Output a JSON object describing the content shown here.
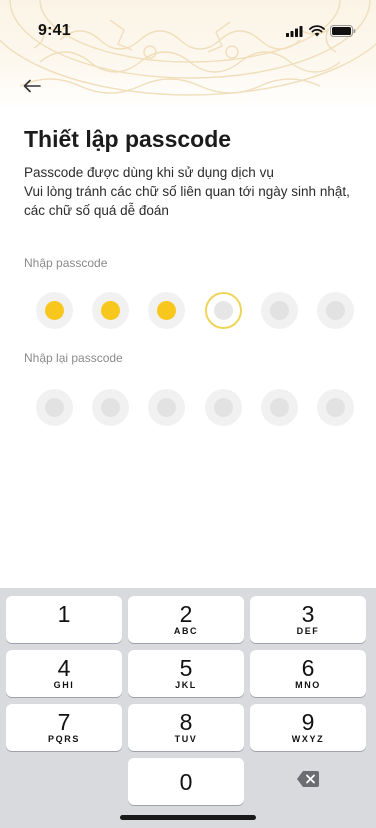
{
  "status_bar": {
    "time": "9:41"
  },
  "header": {
    "back_icon": "arrow-left-icon",
    "title": "Thiết lập passcode"
  },
  "description": {
    "line1": "Passcode được dùng khi sử dụng dịch vụ",
    "line2": "Vui lòng tránh các chữ số liên quan tới ngày sinh nhật, các chữ số quá dễ đoán"
  },
  "passcode": {
    "label": "Nhập passcode",
    "length": 6,
    "filled_count": 3
  },
  "confirm_passcode": {
    "label": "Nhập lại passcode",
    "length": 6,
    "filled_count": 0
  },
  "keypad": {
    "keys": [
      {
        "digit": "1",
        "letters": ""
      },
      {
        "digit": "2",
        "letters": "ABC"
      },
      {
        "digit": "3",
        "letters": "DEF"
      },
      {
        "digit": "4",
        "letters": "GHI"
      },
      {
        "digit": "5",
        "letters": "JKL"
      },
      {
        "digit": "6",
        "letters": "MNO"
      },
      {
        "digit": "7",
        "letters": "PQRS"
      },
      {
        "digit": "8",
        "letters": "TUV"
      },
      {
        "digit": "9",
        "letters": "WXYZ"
      },
      {
        "digit": "0",
        "letters": ""
      }
    ],
    "delete_icon": "backspace-icon"
  },
  "colors": {
    "accent": "#f7c71e",
    "active_ring": "#eed55a",
    "keypad_bg": "#d8dade"
  }
}
